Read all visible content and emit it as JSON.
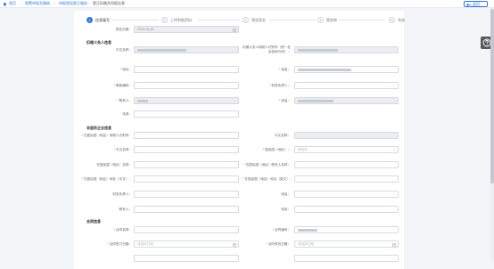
{
  "breadcrumb": {
    "home": "首页",
    "items": [
      "税费申报及缴纳",
      "申报错误更正服务",
      "更正扣缴合同报告表"
    ]
  },
  "return_label": "返回",
  "steps": [
    {
      "num": "1",
      "label": "信息填写",
      "active": true
    },
    {
      "num": "2",
      "label": "上传附报资料",
      "active": false
    },
    {
      "num": "3",
      "label": "预览签名",
      "active": false
    },
    {
      "num": "4",
      "label": "税务审",
      "active": false
    },
    {
      "num": "5",
      "label": "完成",
      "active": false
    }
  ],
  "report_date": {
    "label": "报告日期：",
    "value": "2019-10-16"
  },
  "sections": {
    "party": "扣缴义务人信息",
    "foreign": "非居民企业信息",
    "contract": "合同信息"
  },
  "party_fields": {
    "cn_name": "中文名称：",
    "tax_id": "扣缴义务人纳税人识别号（统一社会信用代码）：",
    "address": "地址：",
    "post_code": "邮政编码：",
    "contact": "联系人：",
    "tax_person": "财务负责人：",
    "phone": "电话：",
    "fax": "传真："
  },
  "foreign_fields": {
    "resident_id": "在居民国（地区）纳税人识别号：",
    "cn_name": "中文名称：",
    "country": "居民国（地区）：",
    "country_ph": "请选择",
    "foreign_name": "在居民国（地区）名称：",
    "foreign_addr": "在居民国（地区）地址：",
    "foreign_contact": "在居民国（地区）联系人名称：",
    "foreign_addr_en": "在居民国（地区）地址（英文）：",
    "foreign_addr_cn": "在居民国（地区）地址（中文）：",
    "finance_head": "财务负责人：",
    "phone": "电话：",
    "contact": "联系人：",
    "fax": "传真："
  },
  "contract_fields": {
    "contract_name": "合同名称：",
    "contract_no": "合同编号：",
    "sign_date": "合同签订日期：",
    "valid_date": "合同有效日期：",
    "date_ph": "请选择日期"
  }
}
